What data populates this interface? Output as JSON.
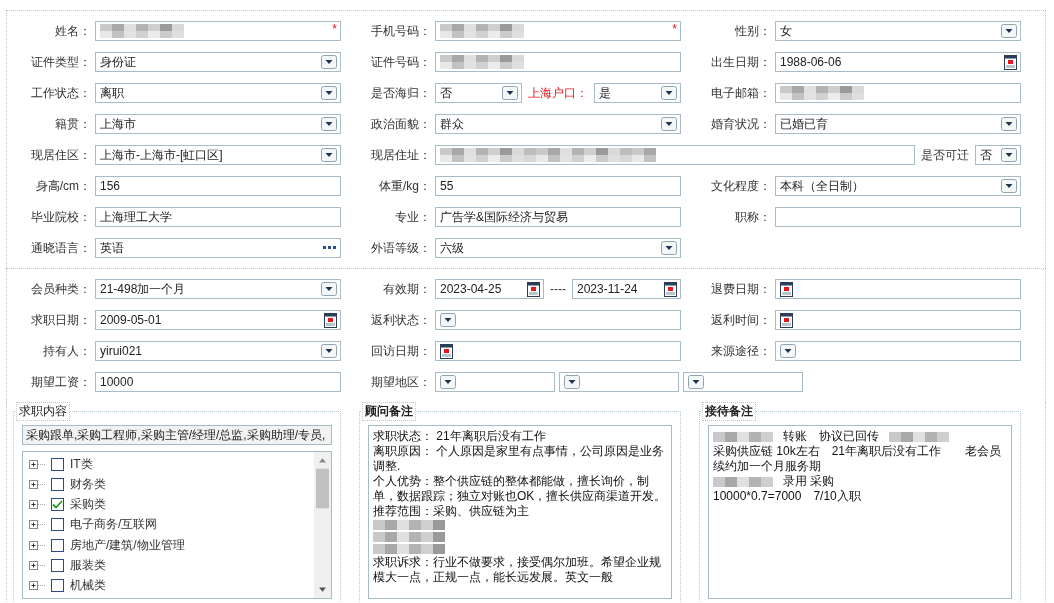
{
  "sections": [
    {
      "rows": [
        {
          "cells": [
            {
              "label": "姓名：",
              "controls": [
                {
                  "kind": "blurred",
                  "required_mark": "*"
                }
              ]
            },
            {
              "label": "手机号码：",
              "controls": [
                {
                  "kind": "blurred",
                  "required_mark": "*"
                }
              ]
            },
            {
              "label": "性别：",
              "controls": [
                {
                  "kind": "select",
                  "value": "女"
                }
              ]
            }
          ]
        },
        {
          "cells": [
            {
              "label": "证件类型：",
              "controls": [
                {
                  "kind": "select",
                  "value": "身份证"
                }
              ]
            },
            {
              "label": "证件号码：",
              "controls": [
                {
                  "kind": "blurred"
                }
              ]
            },
            {
              "label": "出生日期：",
              "controls": [
                {
                  "kind": "date",
                  "value": "1988-06-06"
                }
              ]
            }
          ]
        },
        {
          "cells": [
            {
              "label": "工作状态：",
              "controls": [
                {
                  "kind": "select",
                  "value": "离职"
                }
              ]
            },
            {
              "label": "是否海归：",
              "controls": [
                {
                  "kind": "select",
                  "value": "否"
                },
                {
                  "kind": "label",
                  "text": "上海户口：",
                  "highlight": true
                },
                {
                  "kind": "select",
                  "value": "是"
                }
              ]
            },
            {
              "label": "电子邮箱：",
              "controls": [
                {
                  "kind": "blurred"
                }
              ]
            }
          ]
        },
        {
          "cells": [
            {
              "label": "籍贯：",
              "controls": [
                {
                  "kind": "select",
                  "value": "上海市"
                }
              ]
            },
            {
              "label": "政治面貌：",
              "controls": [
                {
                  "kind": "select",
                  "value": "群众"
                }
              ]
            },
            {
              "label": "婚育状况：",
              "controls": [
                {
                  "kind": "select",
                  "value": "已婚已育"
                }
              ]
            }
          ]
        },
        {
          "cells": [
            {
              "label": "现居住区：",
              "controls": [
                {
                  "kind": "select",
                  "value": "上海市-上海市-[虹口区]"
                }
              ]
            },
            {
              "label": "现居住址：",
              "kind": "wide",
              "controls": [
                {
                  "kind": "blurred"
                },
                {
                  "kind": "label",
                  "text": "是否可迁",
                  "highlight": false
                },
                {
                  "kind": "select_short",
                  "value": "否"
                }
              ]
            }
          ]
        },
        {
          "cells": [
            {
              "label": "身高/cm：",
              "controls": [
                {
                  "kind": "text",
                  "value": "156"
                }
              ]
            },
            {
              "label": "体重/kg：",
              "controls": [
                {
                  "kind": "text",
                  "value": "55"
                }
              ]
            },
            {
              "label": "文化程度：",
              "controls": [
                {
                  "kind": "select",
                  "value": "本科（全日制）"
                }
              ]
            }
          ]
        },
        {
          "cells": [
            {
              "label": "毕业院校：",
              "controls": [
                {
                  "kind": "text",
                  "value": "上海理工大学"
                }
              ]
            },
            {
              "label": "专业：",
              "controls": [
                {
                  "kind": "text",
                  "value": "广告学&国际经济与贸易"
                }
              ]
            },
            {
              "label": "职称：",
              "controls": [
                {
                  "kind": "text"
                }
              ]
            }
          ]
        },
        {
          "cells": [
            {
              "label": "通晓语言：",
              "controls": [
                {
                  "kind": "lookup",
                  "value": "英语"
                }
              ]
            },
            {
              "label": "外语等级：",
              "controls": [
                {
                  "kind": "select",
                  "value": "六级"
                }
              ]
            }
          ]
        }
      ]
    },
    {
      "rows": [
        {
          "cells": [
            {
              "label": "会员种类：",
              "controls": [
                {
                  "kind": "select",
                  "value": "21-498加一个月"
                }
              ]
            },
            {
              "label": "有效期：",
              "controls": [
                {
                  "kind": "date",
                  "value": "2023-04-25"
                },
                {
                  "kind": "label",
                  "text": "----",
                  "highlight": false
                },
                {
                  "kind": "date",
                  "value": "2023-11-24"
                }
              ]
            },
            {
              "label": "退费日期：",
              "controls": [
                {
                  "kind": "date"
                }
              ]
            }
          ]
        },
        {
          "cells": [
            {
              "label": "求职日期：",
              "controls": [
                {
                  "kind": "date",
                  "value": "2009-05-01"
                }
              ]
            },
            {
              "label": "返利状态：",
              "controls": [
                {
                  "kind": "select"
                }
              ]
            },
            {
              "label": "返利时间：",
              "controls": [
                {
                  "kind": "date"
                }
              ]
            }
          ]
        },
        {
          "cells": [
            {
              "label": "持有人：",
              "controls": [
                {
                  "kind": "select",
                  "value": "yirui021"
                }
              ]
            },
            {
              "label": "回访日期：",
              "controls": [
                {
                  "kind": "date"
                }
              ]
            },
            {
              "label": "来源途径：",
              "controls": [
                {
                  "kind": "select"
                }
              ]
            }
          ]
        },
        {
          "cells": [
            {
              "label": "期望工资：",
              "controls": [
                {
                  "kind": "text",
                  "value": "10000"
                }
              ]
            },
            {
              "label": "期望地区：",
              "kind": "wide",
              "controls": [
                {
                  "kind": "select_mid"
                },
                {
                  "kind": "select_mid"
                },
                {
                  "kind": "select_mid"
                }
              ]
            }
          ]
        }
      ]
    }
  ],
  "panels": [
    {
      "title": "求职内容",
      "kind": "tree",
      "summary": "采购跟单,采购工程师,采购主管/经理/总监,采购助理/专员,",
      "items": [
        {
          "label": "IT类",
          "checked": false,
          "expanded": false
        },
        {
          "label": "财务类",
          "checked": false,
          "expanded": false
        },
        {
          "label": "采购类",
          "checked": true,
          "expanded": false
        },
        {
          "label": "电子商务/互联网",
          "checked": false,
          "expanded": false
        },
        {
          "label": "房地产/建筑/物业管理",
          "checked": false,
          "expanded": false
        },
        {
          "label": "服装类",
          "checked": false,
          "expanded": false
        },
        {
          "label": "机械类",
          "checked": false,
          "expanded": false
        }
      ]
    },
    {
      "title": "顾问备注",
      "kind": "notes",
      "lines": [
        {
          "segments": [
            {
              "kind": "text",
              "text": "求职状态： 21年离职后没有工作"
            }
          ]
        },
        {
          "segments": [
            {
              "kind": "text",
              "text": "离职原因： 个人原因是家里有点事情，公司原因是业务调整."
            }
          ]
        },
        {
          "segments": [
            {
              "kind": "text",
              "text": "个人优势：整个供应链的整体都能做，擅长询价，制单，数据跟踪；独立对账也OK，擅长供应商渠道开发。"
            }
          ]
        },
        {
          "segments": [
            {
              "kind": "text",
              "text": "推荐范围：采购、供应链为主"
            }
          ]
        },
        {
          "segments": [
            {
              "kind": "blurred"
            }
          ]
        },
        {
          "segments": [
            {
              "kind": "blurred"
            }
          ]
        },
        {
          "segments": [
            {
              "kind": "blurred"
            }
          ]
        },
        {
          "segments": [
            {
              "kind": "text",
              "text": "求职诉求：行业不做要求，接受偶尔加班。希望企业规模大一点，正规一点，能长远发展。英文一般"
            }
          ]
        }
      ]
    },
    {
      "title": "接待备注",
      "kind": "notes",
      "lines": [
        {
          "segments": [
            {
              "kind": "blurred"
            },
            {
              "kind": "text",
              "text": "转账　协议已回传"
            },
            {
              "kind": "blurred"
            }
          ]
        },
        {
          "segments": [
            {
              "kind": "text",
              "text": "采购供应链 10k左右　21年离职后没有工作　　老会员续约加一个月服务期"
            }
          ]
        },
        {
          "segments": [
            {
              "kind": "blurred"
            },
            {
              "kind": "text",
              "text": "录用 采购"
            }
          ]
        },
        {
          "segments": [
            {
              "kind": "text",
              "text": "10000*0.7=7000　7/10入职"
            }
          ]
        }
      ]
    }
  ]
}
